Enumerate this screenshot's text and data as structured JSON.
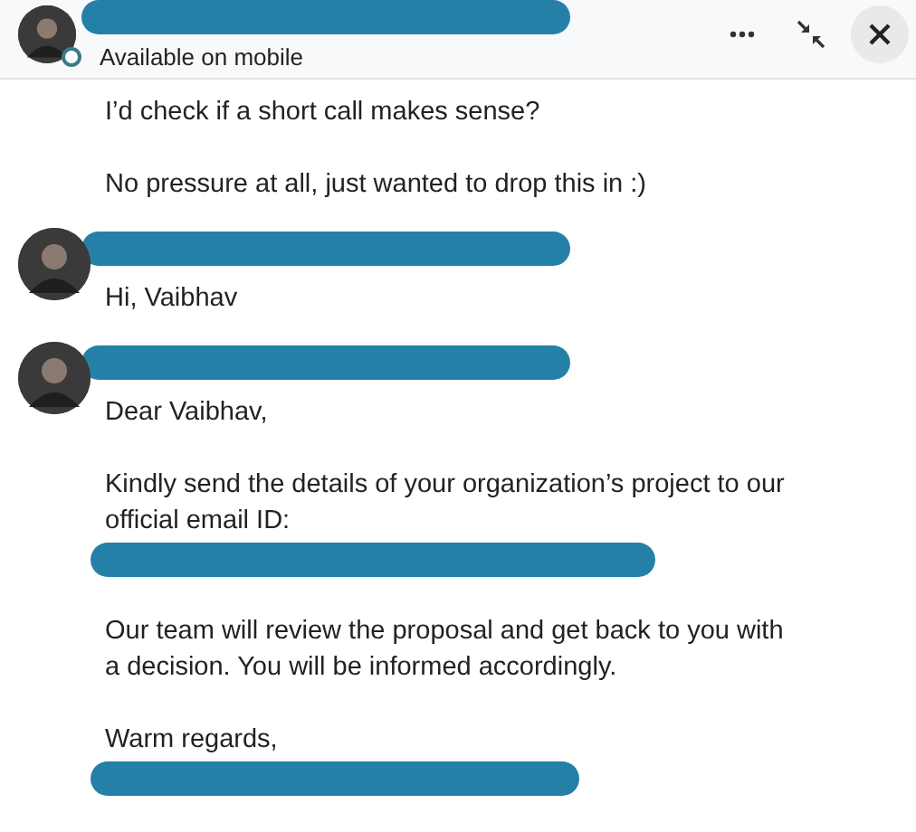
{
  "header": {
    "status": "Available on mobile",
    "online": true,
    "actions": [
      {
        "kind": "more"
      },
      {
        "kind": "collapse"
      },
      {
        "kind": "close"
      }
    ]
  },
  "messages": [
    {
      "avatar": false,
      "lines": [
        {
          "kind": "text",
          "text": "I’d check if a short call makes sense?"
        },
        {
          "kind": "blank"
        },
        {
          "kind": "text",
          "text": "No pressure at all, just wanted to drop this in :)"
        }
      ]
    },
    {
      "avatar": true,
      "lines": [
        {
          "kind": "text",
          "text": "Hi, Vaibhav"
        }
      ]
    },
    {
      "avatar": true,
      "lines": [
        {
          "kind": "text",
          "text": "Dear Vaibhav,"
        },
        {
          "kind": "blank"
        },
        {
          "kind": "text",
          "text": "Kindly send the details of your organization’s project to our"
        },
        {
          "kind": "text",
          "text": "official email ID:"
        },
        {
          "kind": "redacted"
        },
        {
          "kind": "blank"
        },
        {
          "kind": "text",
          "text": "Our team will review the proposal and get back to you with"
        },
        {
          "kind": "text",
          "text": "a decision. You will be informed accordingly."
        },
        {
          "kind": "blank"
        },
        {
          "kind": "text",
          "text": "Warm regards,"
        },
        {
          "kind": "redacted"
        }
      ]
    }
  ]
}
